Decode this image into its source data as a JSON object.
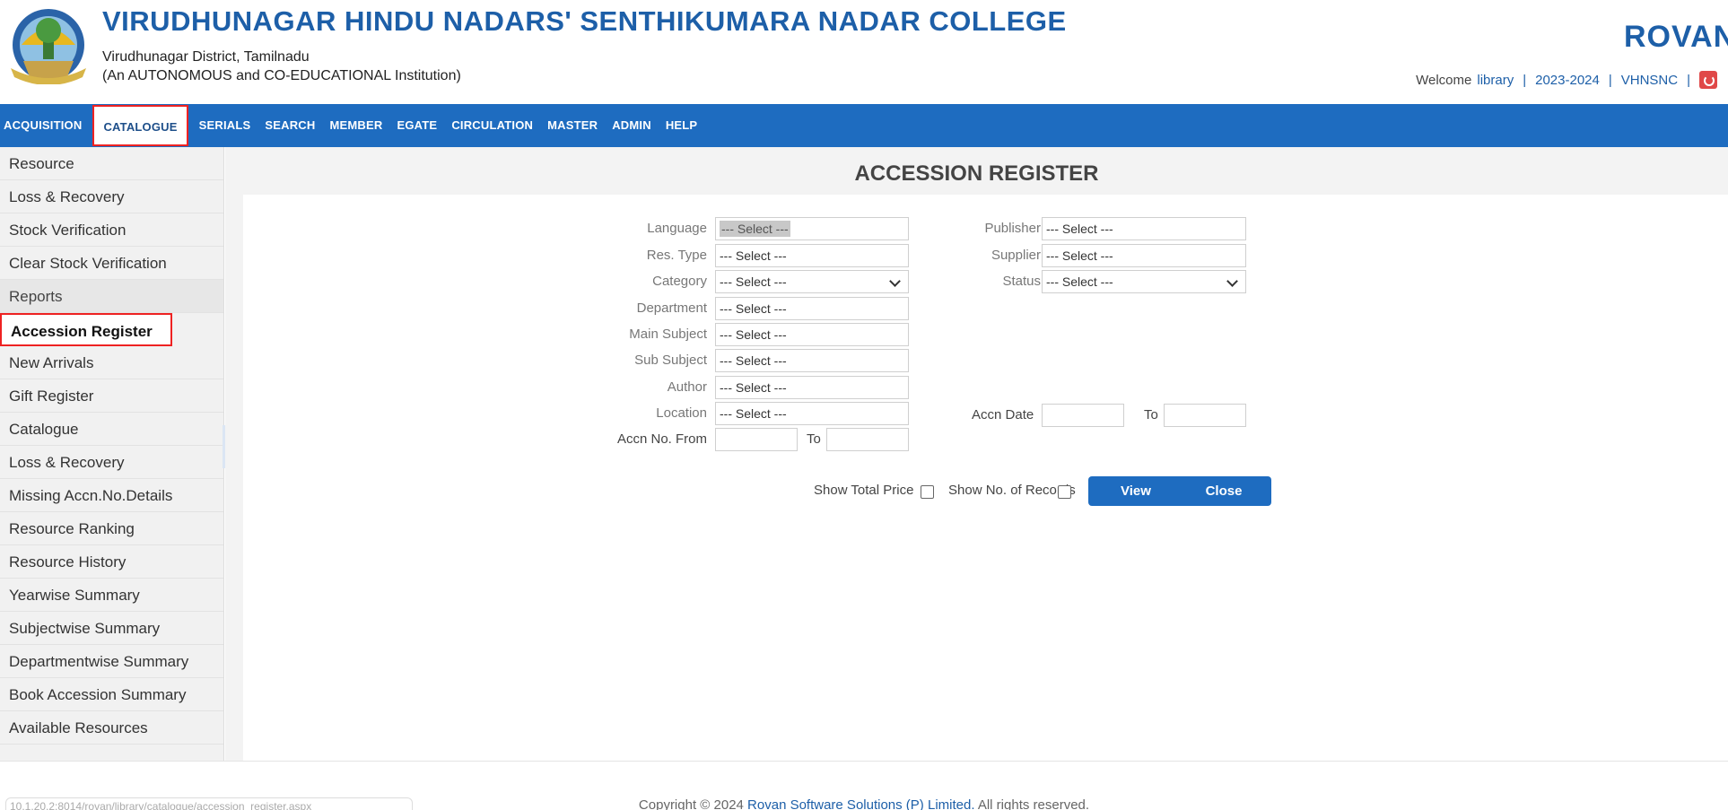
{
  "header": {
    "college_name": "VIRUDHUNAGAR HINDU NADARS' SENTHIKUMARA NADAR COLLEGE",
    "district": "Virudhunagar District, Tamilnadu",
    "status": "(An AUTONOMOUS and CO-EDUCATIONAL Institution)",
    "brand": "ROVAN",
    "brand_mark": "®",
    "welcome_label": "Welcome",
    "user": "library",
    "academic_year": "2023-2024",
    "institution_code": "VHNSNC",
    "separator": "|"
  },
  "nav": {
    "items": [
      "ACQUISITION",
      "CATALOGUE",
      "SERIALS",
      "SEARCH",
      "MEMBER",
      "EGATE",
      "CIRCULATION",
      "MASTER",
      "ADMIN",
      "HELP"
    ],
    "active": "CATALOGUE"
  },
  "sidebar": {
    "items": [
      "Resource",
      "Loss & Recovery",
      "Stock Verification",
      "Clear Stock Verification",
      "Reports",
      "Accession Register",
      "New Arrivals",
      "Gift Register",
      "Catalogue",
      "Loss & Recovery",
      "Missing Accn.No.Details",
      "Resource Ranking",
      "Resource History",
      "Yearwise Summary",
      "Subjectwise Summary",
      "Departmentwise Summary",
      "Book Accession Summary",
      "Available Resources"
    ],
    "active": "Accession Register",
    "section": "Reports"
  },
  "main": {
    "title": "ACCESSION REGISTER",
    "left_fields": {
      "language": {
        "label": "Language",
        "value": "--- Select ---"
      },
      "res_type": {
        "label": "Res. Type",
        "value": "--- Select ---"
      },
      "category": {
        "label": "Category",
        "value": "--- Select ---"
      },
      "department": {
        "label": "Department",
        "value": "--- Select ---"
      },
      "main_subject": {
        "label": "Main Subject",
        "value": "--- Select ---"
      },
      "sub_subject": {
        "label": "Sub Subject",
        "value": "--- Select ---"
      },
      "author": {
        "label": "Author",
        "value": "--- Select ---"
      },
      "location": {
        "label": "Location",
        "value": "--- Select ---"
      },
      "accn_no_from": {
        "label": "Accn No. From",
        "value": ""
      },
      "accn_no_to": {
        "label": "To",
        "value": ""
      }
    },
    "right_fields": {
      "publisher": {
        "label": "Publisher",
        "value": "--- Select ---"
      },
      "supplier": {
        "label": "Supplier",
        "value": "--- Select ---"
      },
      "status": {
        "label": "Status",
        "value": "--- Select ---"
      },
      "accn_date": {
        "label": "Accn Date",
        "value": ""
      },
      "accn_date_to": {
        "label": "To",
        "value": ""
      }
    },
    "options": {
      "show_total_price": "Show Total Price",
      "show_no_of_records": "Show No. of Records"
    },
    "buttons": {
      "view": "View",
      "close": "Close"
    }
  },
  "footer": {
    "copyright_prefix": "Copyright © 2024",
    "copyright_company": "Rovan Software Solutions (P) Limited.",
    "copyright_suffix": "All rights reserved.",
    "url_text": "10.1.20.2:8014/rovan/library/catalogue/accession_register.aspx"
  },
  "colors": {
    "brand_blue": "#1d5fa8",
    "nav_blue": "#1e6cc0",
    "highlight_red": "#ee2222"
  }
}
